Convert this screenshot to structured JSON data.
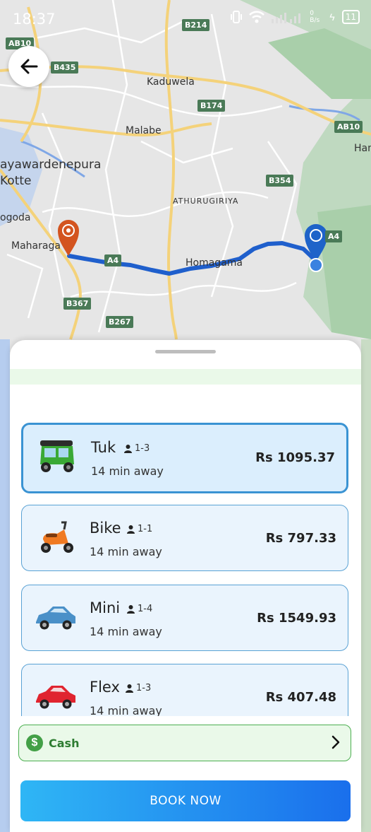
{
  "status_bar": {
    "time": "18:37",
    "network_speed": "0 B/s",
    "battery": "11"
  },
  "map": {
    "places": [
      "Kaduwela",
      "Malabe",
      "ayawardenepura Kotte",
      "ATHURUGIRIYA",
      "Homagama",
      "Maharaga",
      "ogoda",
      "Han"
    ],
    "road_shields": [
      "B214",
      "AB10",
      "B435",
      "B174",
      "AB10",
      "B354",
      "A4",
      "A4",
      "B367",
      "B267"
    ],
    "colors": {
      "route": "#1f5fcc",
      "origin_pin": "#d3541f",
      "destination_pin": "#1e63c9"
    }
  },
  "rides": [
    {
      "name": "Tuk",
      "capacity": "1-3",
      "eta": "14 min away",
      "price": "Rs 1095.37",
      "selected": true,
      "icon": "tuk-tuk-icon"
    },
    {
      "name": "Bike",
      "capacity": "1-1",
      "eta": "14 min away",
      "price": "Rs 797.33",
      "selected": false,
      "icon": "scooter-icon"
    },
    {
      "name": "Mini",
      "capacity": "1-4",
      "eta": "14 min away",
      "price": "Rs 1549.93",
      "selected": false,
      "icon": "blue-car-icon"
    },
    {
      "name": "Flex",
      "capacity": "1-3",
      "eta": "14 min away",
      "price": "Rs 407.48",
      "selected": false,
      "icon": "red-car-icon"
    }
  ],
  "payment": {
    "method": "Cash",
    "icon": "dollar-icon"
  },
  "book_button": {
    "label": "BOOK NOW"
  },
  "colors": {
    "accent": "#1a8ff0",
    "payment_green": "#43a047"
  }
}
